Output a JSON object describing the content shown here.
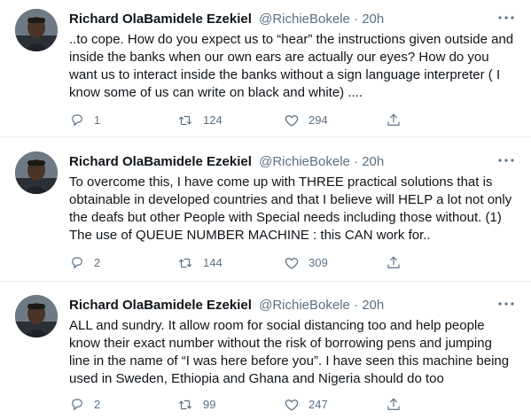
{
  "tweets": [
    {
      "name": "Richard OlaBamidele Ezekiel",
      "handle": "@RichieBokele",
      "separator": "·",
      "time": "20h",
      "text": "..to cope. How do you expect us to “hear” the instructions given outside and inside the banks when our own ears are actually our eyes? How do you want us to interact inside the banks without a sign language interpreter ( I know some of us can write on black and white) ....",
      "replies": "1",
      "retweets": "124",
      "likes": "294"
    },
    {
      "name": "Richard OlaBamidele Ezekiel",
      "handle": "@RichieBokele",
      "separator": "·",
      "time": "20h",
      "text": "To overcome this, I have come up with THREE practical solutions that is obtainable in developed countries and that I believe will HELP a lot not only the deafs but other People with Special needs including those without.  (1) The use of QUEUE NUMBER MACHINE : this CAN work for..",
      "replies": "2",
      "retweets": "144",
      "likes": "309"
    },
    {
      "name": "Richard OlaBamidele Ezekiel",
      "handle": "@RichieBokele",
      "separator": "·",
      "time": "20h",
      "text": "ALL and sundry. It allow room for social distancing too and help people know their exact number without the risk of borrowing pens and jumping line in the name of “I was here before you”. I have seen this machine being used in Sweden, Ethiopia and Ghana and Nigeria should do too",
      "replies": "2",
      "retweets": "99",
      "likes": "247"
    }
  ],
  "icons": {
    "reply": "reply-icon",
    "retweet": "retweet-icon",
    "like": "heart-icon",
    "share": "share-icon",
    "more": "more-options-icon"
  },
  "colors": {
    "text_primary": "#0f1419",
    "text_secondary": "#5b7083",
    "divider": "#e6ecf0"
  }
}
